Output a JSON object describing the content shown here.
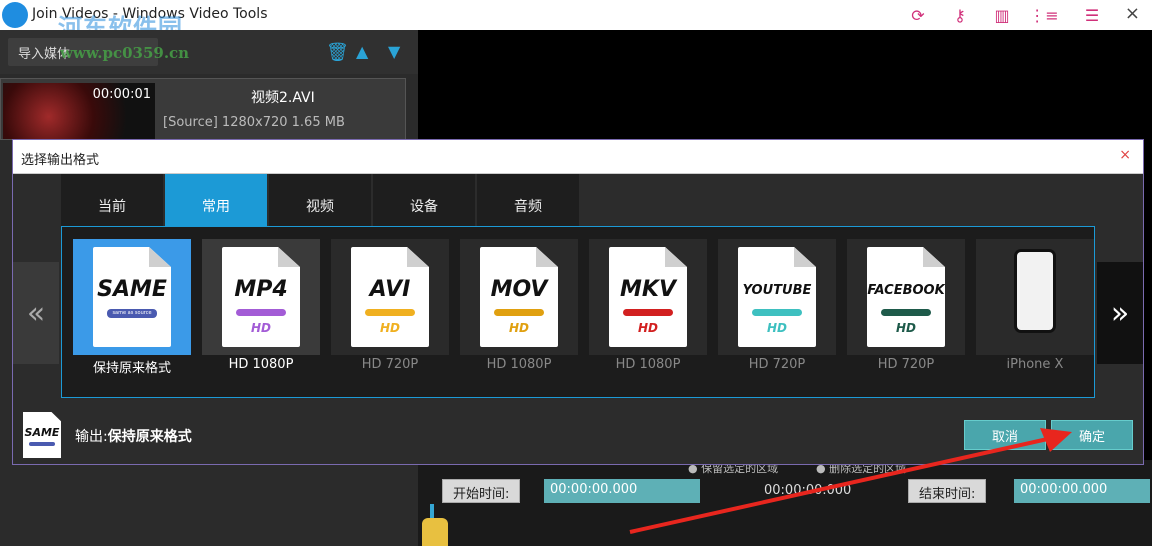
{
  "titlebar": {
    "title": "Join Videos - Windows Video Tools",
    "watermark_logo": "河东软件园",
    "watermark_url": "www.pc0359.cn",
    "close_glyph": "×"
  },
  "left_panel": {
    "import_label": "导入媒体",
    "media": {
      "name": "视频2.AVI",
      "duration": "00:00:01",
      "info": "[Source] 1280x720 1.65 MB"
    }
  },
  "timeline": {
    "start_label": "开始时间:",
    "start_value": "00:00:00.000",
    "mid_value": "00:00:00.000",
    "end_label": "结束时间:",
    "end_value": "00:00:00.000",
    "radio1": "● 保留选定的区域",
    "radio2": "● 删除选定的区域"
  },
  "dialog": {
    "title": "选择输出格式",
    "close_glyph": "×",
    "tabs": [
      "当前",
      "常用",
      "视频",
      "设备",
      "音频"
    ],
    "active_tab": "常用",
    "prev_glyph": "«",
    "next_glyph": "»",
    "formats": [
      {
        "label": "SAME",
        "sub": "same as source",
        "caption": "保持原来格式",
        "bar": "#4a5ab0",
        "sub_color": "#ffffff"
      },
      {
        "label": "MP4",
        "sub": "HD",
        "badge": "1080P",
        "caption": "HD 1080P",
        "bar": "#a35cd6",
        "sub_color": "#a35cd6"
      },
      {
        "label": "AVI",
        "sub": "HD",
        "badge": "720P",
        "caption": "HD 720P",
        "bar": "#f0b020",
        "sub_color": "#f0b020"
      },
      {
        "label": "MOV",
        "sub": "HD",
        "badge": "1080P",
        "caption": "HD 1080P",
        "bar": "#e0a010",
        "sub_color": "#e0a010"
      },
      {
        "label": "MKV",
        "sub": "HD",
        "badge": "1080P",
        "caption": "HD 1080P",
        "bar": "#d22020",
        "sub_color": "#d22020"
      },
      {
        "label": "YOUTUBE",
        "sub": "HD",
        "badge": "720P",
        "caption": "HD 720P",
        "bar": "#3ec0c0",
        "sub_color": "#3ec0c0"
      },
      {
        "label": "FACEBOOK",
        "sub": "HD",
        "badge": "720P",
        "caption": "HD 720P",
        "bar": "#1e5a4a",
        "sub_color": "#1e5a4a"
      },
      {
        "label": "",
        "sub": "",
        "caption": "iPhone X",
        "bar": "",
        "sub_color": ""
      }
    ],
    "output_prefix": "输出:",
    "output_value": "保持原来格式",
    "output_icon_label": "SAME",
    "cancel_label": "取消",
    "ok_label": "确定"
  },
  "colors": {
    "accent": "#1c9ad6",
    "selected_card": "#3b9ae8",
    "button": "#4aa6ac",
    "arrow": "#e8261e"
  }
}
